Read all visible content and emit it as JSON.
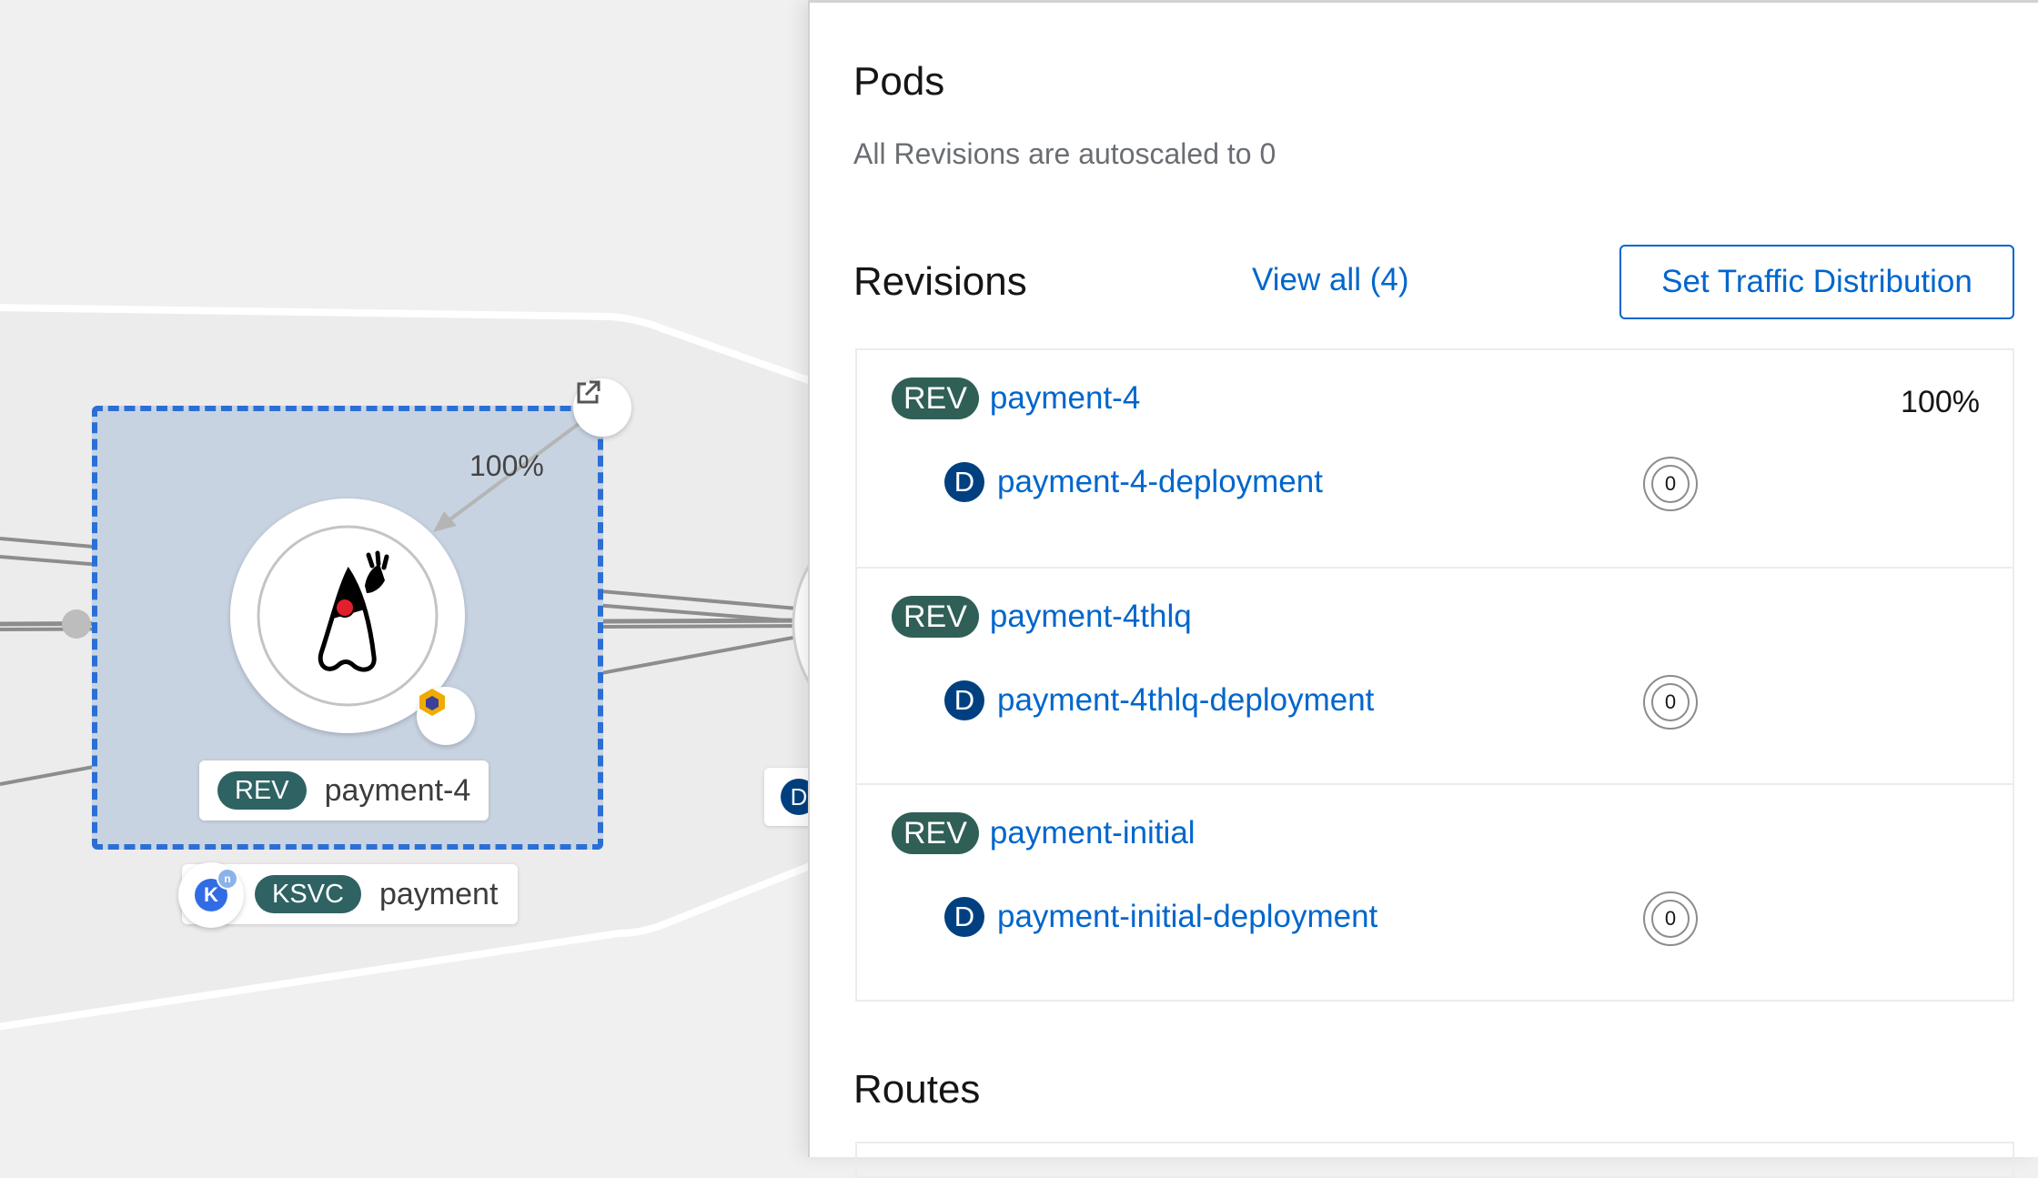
{
  "topology": {
    "revision_node": {
      "badge": "REV",
      "name": "payment-4",
      "traffic": "100%"
    },
    "service_node": {
      "badge": "KSVC",
      "name": "payment",
      "icon_letter": "K",
      "icon_sup": "n"
    },
    "partial_badge": "D"
  },
  "panel": {
    "pods": {
      "heading": "Pods",
      "text": "All Revisions are autoscaled to 0"
    },
    "revisions": {
      "heading": "Revisions",
      "view_all": "View all (4)",
      "traffic_button": "Set Traffic Distribution",
      "items": [
        {
          "badge": "REV",
          "name": "payment-4",
          "traffic": "100%",
          "dep_badge": "D",
          "deployment": "payment-4-deployment",
          "pods": "0"
        },
        {
          "badge": "REV",
          "name": "payment-4thlq",
          "traffic": "",
          "dep_badge": "D",
          "deployment": "payment-4thlq-deployment",
          "pods": "0"
        },
        {
          "badge": "REV",
          "name": "payment-initial",
          "traffic": "",
          "dep_badge": "D",
          "deployment": "payment-initial-deployment",
          "pods": "0"
        }
      ]
    },
    "routes": {
      "heading": "Routes"
    }
  }
}
